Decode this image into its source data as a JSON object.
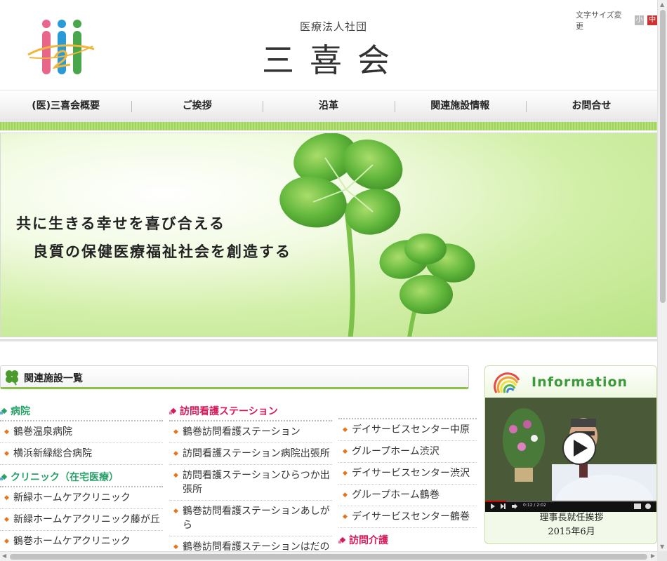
{
  "header": {
    "org_small": "医療法人社団",
    "org_name": "三喜会",
    "font_size_label": "文字サイズ変更",
    "font_size_small": "小",
    "font_size_mid": "中"
  },
  "nav": {
    "items": [
      {
        "label": "(医)三喜会概要"
      },
      {
        "label": "ご挨拶"
      },
      {
        "label": "沿革"
      },
      {
        "label": "関連施設情報"
      },
      {
        "label": "お問合せ"
      }
    ]
  },
  "hero": {
    "line1": "共に生きる幸せを喜び合える",
    "line2": "良質の保健医療福祉社会を創造する"
  },
  "facilities": {
    "title": "関連施設一覧",
    "col1": {
      "cat1": "病院",
      "cat1_items": [
        "鶴巻温泉病院",
        "横浜新緑総合病院"
      ],
      "cat2": "クリニック（在宅医療）",
      "cat2_items": [
        "新緑ホームケアクリニック",
        "新緑ホームケアクリニック藤が丘",
        "鶴巻ホームケアクリニック"
      ]
    },
    "col2": {
      "cat1": "訪問看護ステーション",
      "cat1_items": [
        "鶴巻訪問看護ステーション",
        "訪問看護ステーション病院出張所",
        "訪問看護ステーションひらつか出張所",
        "鶴巻訪問看護ステーションあしがら",
        "鶴巻訪問看護ステーションはだの"
      ]
    },
    "col3": {
      "items": [
        "デイサービスセンター中原",
        "グループホーム渋沢",
        "デイサービスセンター渋沢",
        "グループホーム鶴巻",
        "デイサービスセンター鶴巻"
      ],
      "cat2": "訪問介護"
    }
  },
  "info": {
    "title": "Information",
    "video_time": "0:12 / 2:02",
    "caption": "理事長就任挨拶",
    "date": "2015年6月"
  },
  "colors": {
    "accent_green": "#8cc24a",
    "category_green": "#2aa06a",
    "category_pink": "#d6195a",
    "arrow_orange": "#e8731b"
  }
}
